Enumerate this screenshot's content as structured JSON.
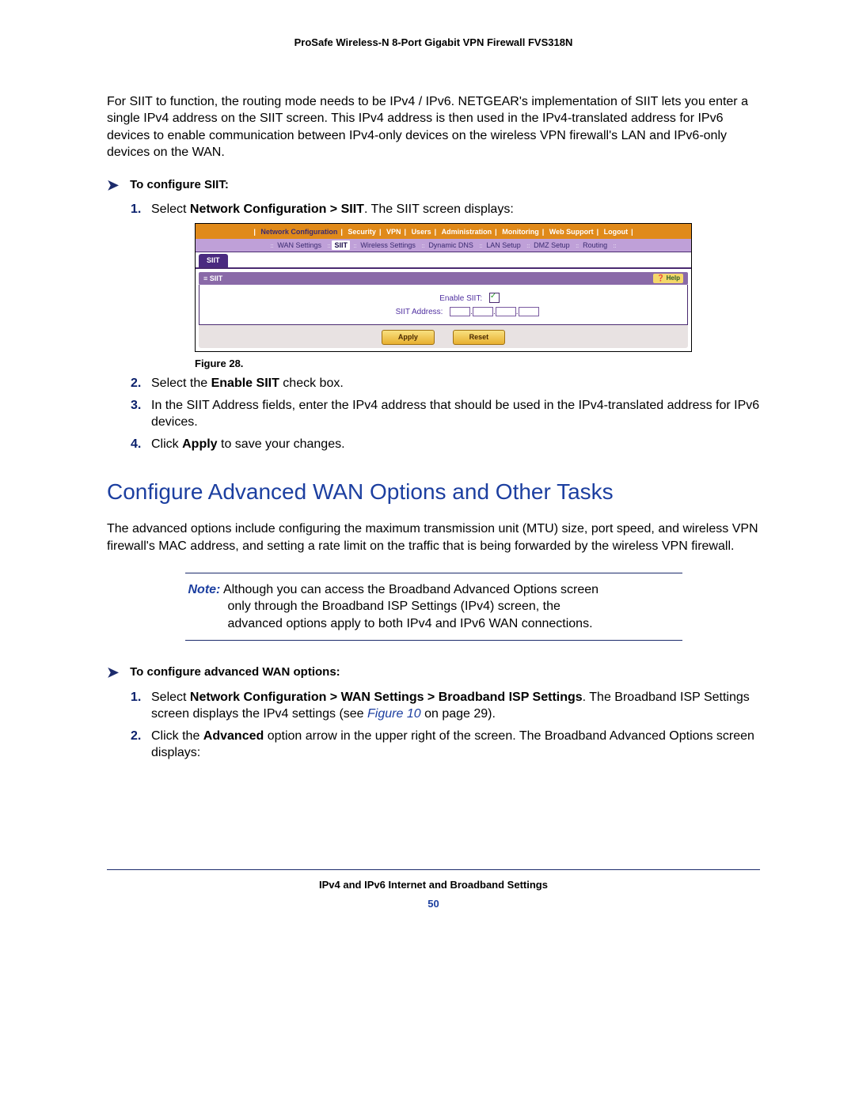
{
  "header": "ProSafe Wireless-N 8-Port Gigabit VPN Firewall FVS318N",
  "intro": "For SIIT to function, the routing mode needs to be IPv4 / IPv6. NETGEAR's implementation of SIIT lets you enter a single IPv4 address on the SIIT screen. This IPv4 address is then used in the IPv4-translated address for IPv6 devices to enable communication between IPv4-only devices on the wireless VPN firewall's LAN and IPv6-only devices on the WAN.",
  "task1": {
    "title": "To configure SIIT:",
    "s1_pre": "Select ",
    "s1_bold": "Network Configuration > SIIT",
    "s1_post": ". The SIIT screen displays:",
    "s2_pre": "Select the ",
    "s2_bold": "Enable SIIT",
    "s2_post": " check box.",
    "s3": "In the SIIT Address fields, enter the IPv4 address that should be used in the IPv4-translated address for IPv6 devices.",
    "s4_pre": "Click ",
    "s4_bold": "Apply",
    "s4_post": " to save your changes."
  },
  "fig_caption": "Figure 28.",
  "shot": {
    "nav": [
      "Network Configuration",
      "Security",
      "VPN",
      "Users",
      "Administration",
      "Monitoring",
      "Web Support",
      "Logout"
    ],
    "subnav": [
      "WAN Settings",
      "SIIT",
      "Wireless Settings",
      "Dynamic DNS",
      "LAN Setup",
      "DMZ Setup",
      "Routing"
    ],
    "subnav_selected": "SIIT",
    "tab": "SIIT",
    "bar": "SIIT",
    "help": "Help",
    "enable_label": "Enable SIIT:",
    "addr_label": "SIIT Address:",
    "apply": "Apply",
    "reset": "Reset"
  },
  "section_heading": "Configure Advanced WAN Options and Other Tasks",
  "section_para": "The advanced options include configuring the maximum transmission unit (MTU) size, port speed, and wireless VPN firewall's MAC address, and setting a rate limit on the traffic that is being forwarded by the wireless VPN firewall.",
  "note": {
    "label": "Note:",
    "line1": "  Although you can access the Broadband Advanced Options screen",
    "line2": "only through the Broadband ISP Settings (IPv4) screen, the",
    "line3": "advanced options apply to both IPv4 and IPv6 WAN connections."
  },
  "task2": {
    "title": "To configure advanced WAN options:",
    "s1_pre": "Select ",
    "s1_bold": "Network Configuration > WAN Settings > Broadband ISP Settings",
    "s1_post1": ". The Broadband ISP Settings screen displays the IPv4 settings (see ",
    "s1_link": "Figure 10",
    "s1_post2": " on page 29).",
    "s2_pre": "Click the ",
    "s2_bold": "Advanced",
    "s2_post": " option arrow in the upper right of the screen. The Broadband Advanced Options screen displays:"
  },
  "footer": "IPv4 and IPv6 Internet and Broadband Settings",
  "page_num": "50"
}
